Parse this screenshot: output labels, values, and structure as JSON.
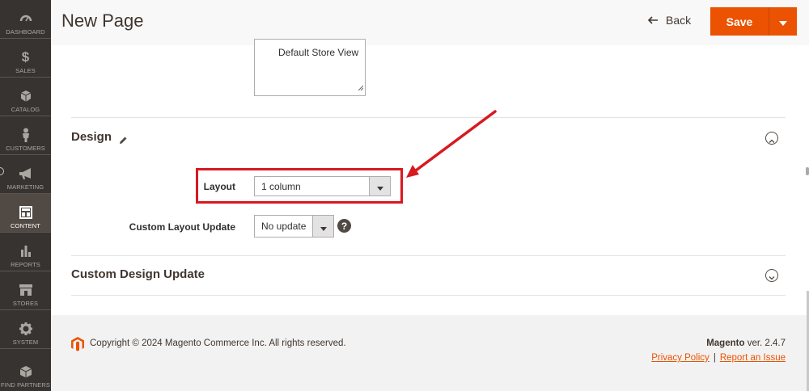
{
  "sidebar": {
    "items": [
      {
        "label": "Dashboard",
        "icon": "dashboard-icon",
        "active": false
      },
      {
        "label": "Sales",
        "icon": "dollar-icon",
        "active": false
      },
      {
        "label": "Catalog",
        "icon": "cube-icon",
        "active": false
      },
      {
        "label": "Customers",
        "icon": "person-icon",
        "active": false
      },
      {
        "label": "Marketing",
        "icon": "megaphone-icon",
        "active": false
      },
      {
        "label": "Content",
        "icon": "layout-icon",
        "active": true
      },
      {
        "label": "Reports",
        "icon": "bar-chart-icon",
        "active": false
      },
      {
        "label": "Stores",
        "icon": "storefront-icon",
        "active": false
      },
      {
        "label": "System",
        "icon": "gear-icon",
        "active": false
      },
      {
        "label": "Find Partners",
        "icon": "box-icon",
        "active": false
      }
    ]
  },
  "header": {
    "title": "New Page",
    "back_label": "Back",
    "save_label": "Save"
  },
  "store_view": {
    "selected_option": "Default Store View"
  },
  "design": {
    "title": "Design",
    "layout_label": "Layout",
    "layout_value": "1 column",
    "custom_layout_label": "Custom Layout Update",
    "custom_layout_value": "No update"
  },
  "custom_design": {
    "title": "Custom Design Update"
  },
  "footer": {
    "copyright": "Copyright © 2024 Magento Commerce Inc. All rights reserved.",
    "brand": "Magento",
    "version": "ver. 2.4.7",
    "privacy_link": "Privacy Policy",
    "separator": "|",
    "report_link": "Report an Issue"
  },
  "colors": {
    "accent": "#eb5202",
    "sidebar_bg": "#373330",
    "highlight": "#d71920"
  }
}
